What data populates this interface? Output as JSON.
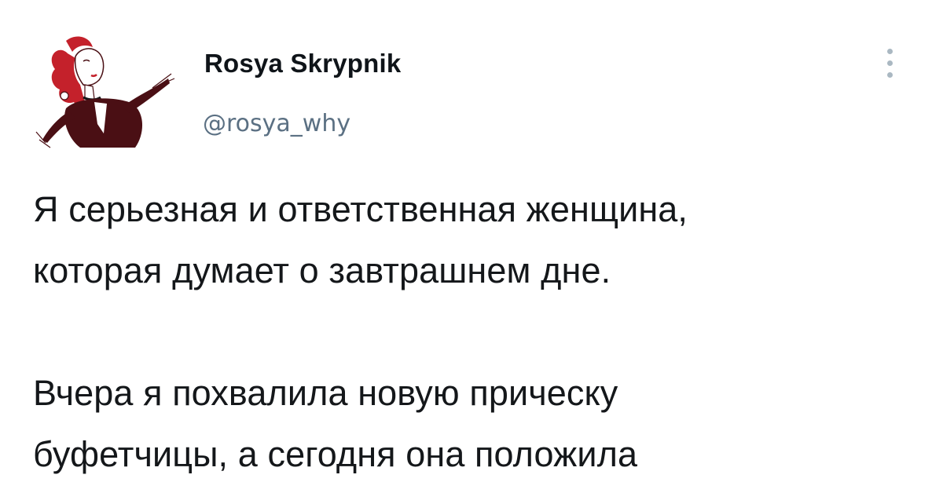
{
  "tweet": {
    "author": {
      "display_name": "Rosya Skrypnik",
      "handle": "@rosya_why"
    },
    "text_lines": [
      "Я серьезная и ответственная женщина,",
      "которая думает о завтрашнем дне.",
      "",
      "Вчера я похвалила новую прическу",
      "буфетчицы, а сегодня она положила"
    ]
  },
  "icons": {
    "more": "more-options-icon",
    "avatar": "avatar-illustration"
  },
  "colors": {
    "text": "#14171a",
    "secondary_text": "#5b7083",
    "avatar_red": "#c4212b",
    "avatar_dark": "#4a0f14",
    "dots": "#aab8c2"
  }
}
